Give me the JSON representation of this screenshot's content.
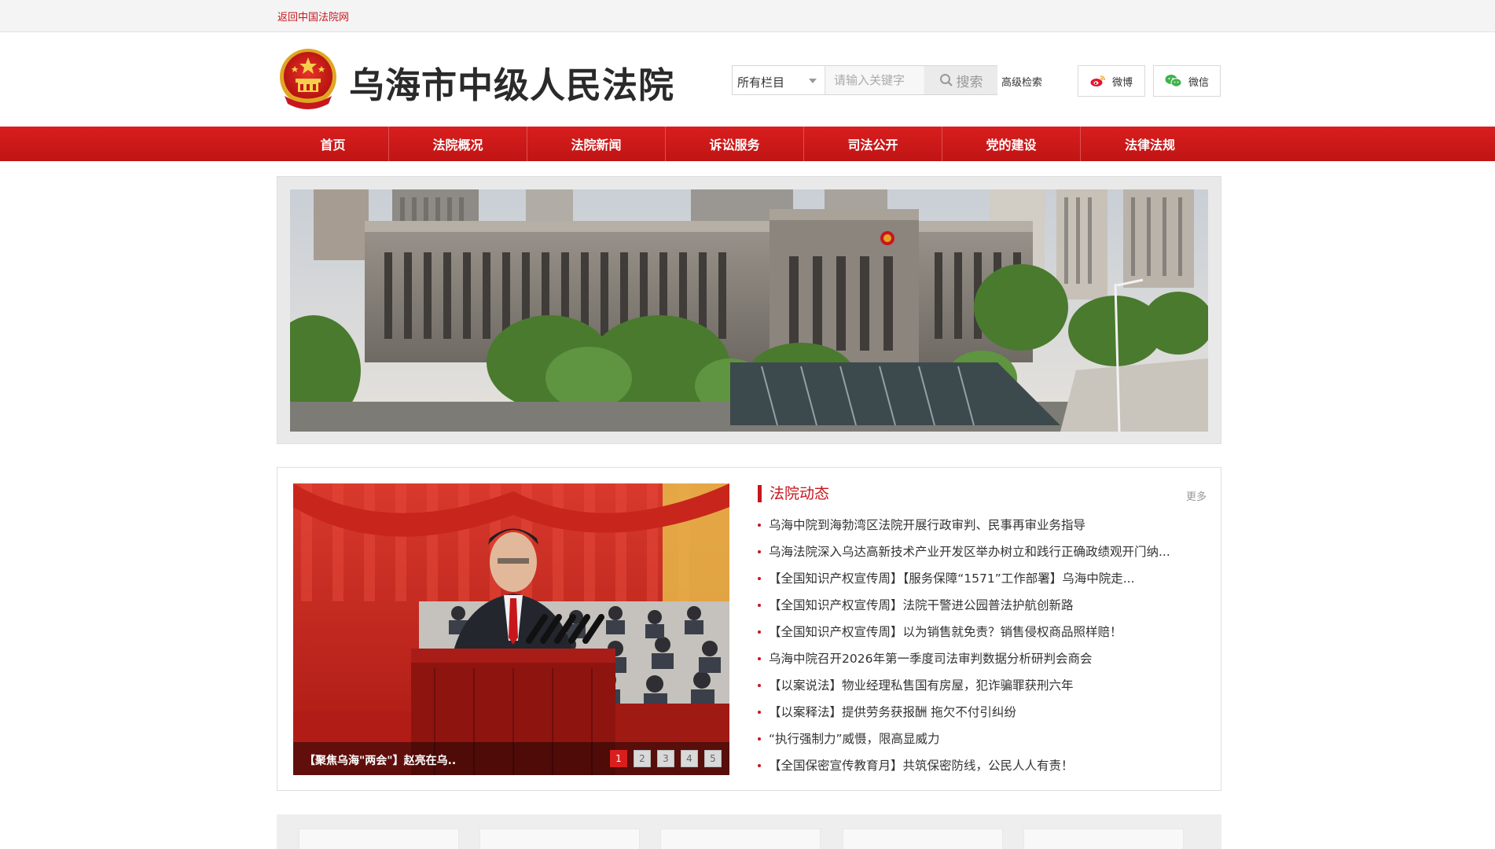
{
  "topbar": {
    "return_link": "返回中国法院网"
  },
  "header": {
    "site_title": "乌海市中级人民法院",
    "emblem": "national-emblem"
  },
  "search": {
    "category_selected": "所有栏目",
    "placeholder": "请输入关键字",
    "button_label": "搜索",
    "advanced_label": "高级检索"
  },
  "social": {
    "weibo_label": "微博",
    "wechat_label": "微信"
  },
  "nav": {
    "items": [
      {
        "label": "首页"
      },
      {
        "label": "法院概况"
      },
      {
        "label": "法院新闻"
      },
      {
        "label": "诉讼服务"
      },
      {
        "label": "司法公开"
      },
      {
        "label": "党的建设"
      },
      {
        "label": "法律法规"
      }
    ]
  },
  "slider": {
    "caption": "【聚焦乌海\"两会\"】赵亮在乌..",
    "pages": [
      "1",
      "2",
      "3",
      "4",
      "5"
    ],
    "active_page": 1
  },
  "news": {
    "heading": "法院动态",
    "more_label": "更多",
    "items": [
      "乌海中院到海勃湾区法院开展行政审判、民事再审业务指导",
      "乌海法院深入乌达高新技术产业开发区举办树立和践行正确政绩观开门纳...",
      "【全国知识产权宣传周】【服务保障“1571”工作部署】乌海中院走...",
      "【全国知识产权宣传周】法院干警进公园普法护航创新路",
      "【全国知识产权宣传周】以为销售就免责？销售侵权商品照样赔！",
      "乌海中院召开2026年第一季度司法审判数据分析研判会商会",
      "【以案说法】物业经理私售国有房屋，犯诈骗罪获刑六年",
      "【以案释法】提供劳务获报酬 拖欠不付引纠纷",
      "“执行强制力”威慑，限高显威力",
      "【全国保密宣传教育月】共筑保密防线，公民人人有责！"
    ]
  },
  "colors": {
    "brand_red": "#c8161d",
    "nav_red": "#d91e1e"
  }
}
